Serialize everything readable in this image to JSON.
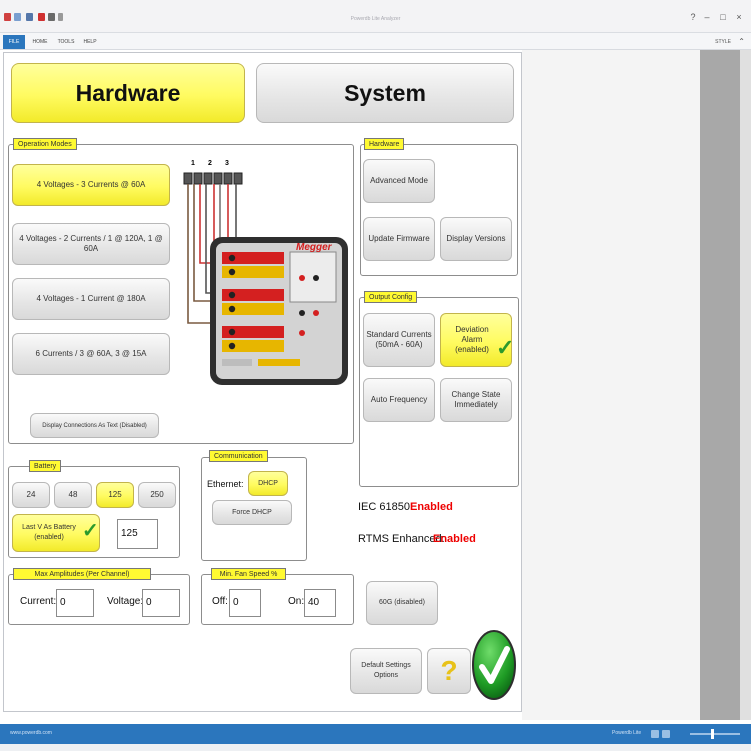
{
  "window": {
    "title": "Powerdb Lite Analyzer"
  },
  "ribbon": {
    "tabs": [
      "FILE",
      "HOME",
      "TOOLS",
      "HELP"
    ],
    "right_label": "STYLE"
  },
  "header_tabs": {
    "hardware": "Hardware",
    "system": "System"
  },
  "operation_modes": {
    "title": "Operation Modes",
    "buttons": [
      "4 Voltages - 3 Currents @ 60A",
      "4 Voltages - 2 Currents / 1 @ 120A, 1 @ 60A",
      "4 Voltages - 1 Current @ 180A",
      "6 Currents / 3 @ 60A, 3 @ 15A"
    ],
    "selected": 0,
    "display_connections": "Display Connections As Text (Disabled)"
  },
  "diagram": {
    "terminal_labels": [
      "1",
      "2",
      "3"
    ],
    "brand": "Megger"
  },
  "hardware_panel": {
    "title": "Hardware",
    "advanced_mode": "Advanced Mode",
    "update_firmware": "Update Firmware",
    "display_versions": "Display Versions"
  },
  "output_config": {
    "title": "Output Config",
    "standard_currents": "Standard Currents (50mA - 60A)",
    "deviation_alarm": "Deviation Alarm (enabled)",
    "auto_frequency": "Auto Frequency",
    "change_state": "Change State Immediately"
  },
  "battery": {
    "title": "Battery",
    "options": [
      "24",
      "48",
      "125",
      "250"
    ],
    "selected": "125",
    "last_v": "Last V As Battery (enabled)",
    "value": "125"
  },
  "communication": {
    "title": "Communication",
    "ethernet_label": "Ethernet:",
    "dhcp": "DHCP",
    "force_dhcp": "Force DHCP"
  },
  "status": {
    "iec_label": "IEC 61850:",
    "iec_value": "Enabled",
    "rtms_label": "RTMS Enhanced:",
    "rtms_value": "Enabled"
  },
  "max_amplitudes": {
    "title": "Max Amplitudes (Per Channel)",
    "current_label": "Current:",
    "current_value": "0",
    "voltage_label": "Voltage:",
    "voltage_value": "0"
  },
  "fan": {
    "title": "Min. Fan Speed %",
    "off_label": "Off:",
    "off_value": "0",
    "on_label": "On:",
    "on_value": "40"
  },
  "buttons": {
    "b60g": "60G (disabled)",
    "default_settings": "Default Settings Options",
    "help": "?"
  },
  "statusbar": {
    "url": "www.powerdb.com",
    "right": "Powerdb Lite"
  }
}
